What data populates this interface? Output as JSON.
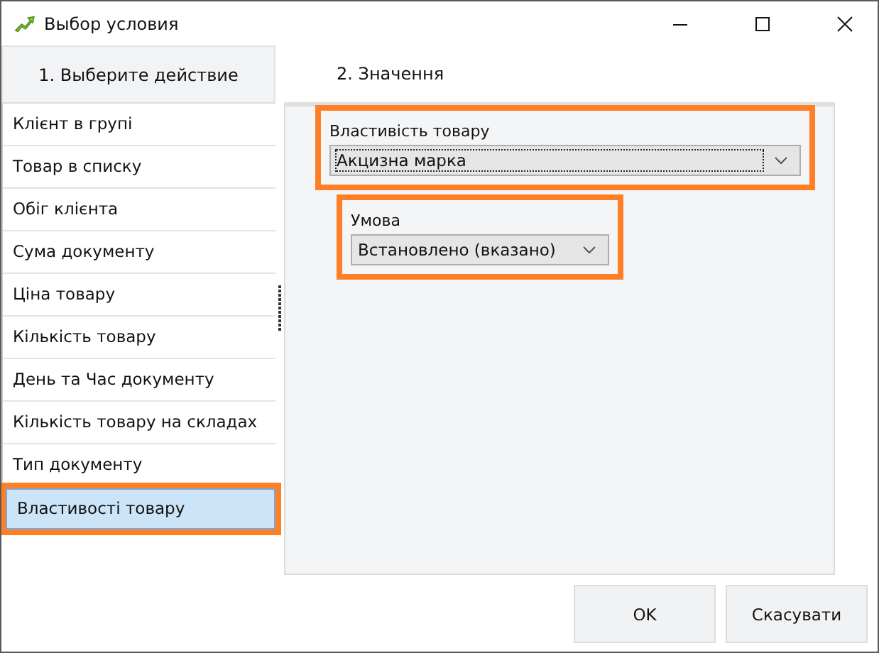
{
  "window": {
    "title": "Выбор условия"
  },
  "steps": [
    {
      "label": "1. Выберите  действие",
      "selected": true
    },
    {
      "label": "2. Значення",
      "selected": false
    }
  ],
  "actions": [
    {
      "label": "Клієнт в групі",
      "selected": false
    },
    {
      "label": "Товар в списку",
      "selected": false
    },
    {
      "label": "Обіг клієнта",
      "selected": false
    },
    {
      "label": "Сума документу",
      "selected": false
    },
    {
      "label": "Ціна товару",
      "selected": false
    },
    {
      "label": "Кількість товару",
      "selected": false
    },
    {
      "label": "День та Час документу",
      "selected": false
    },
    {
      "label": "Кількість товару на складах",
      "selected": false
    },
    {
      "label": "Тип документу",
      "selected": false
    },
    {
      "label": "Властивості товару",
      "selected": true,
      "highlighted": true
    }
  ],
  "fields": [
    {
      "label": "Властивість товару",
      "value": "Акцизна марка",
      "focused": true,
      "highlighted": true
    },
    {
      "label": "Умова",
      "value": "Встановлено (вказано)",
      "focused": false,
      "highlighted": true
    }
  ],
  "buttons": [
    "OK",
    "Скасувати"
  ]
}
